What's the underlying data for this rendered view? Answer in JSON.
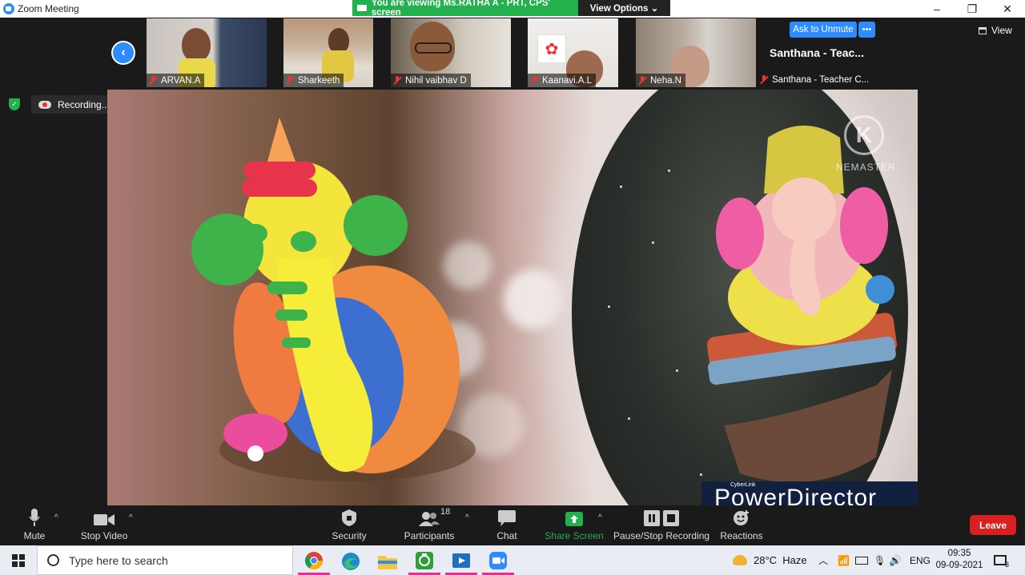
{
  "window": {
    "title": "Zoom Meeting",
    "minimize": "–",
    "maximize": "❐",
    "close": "✕"
  },
  "share_banner": {
    "viewing_text": "You are viewing Ms.RATHA A - PRT, CPS' screen",
    "view_options": "View Options ⌄"
  },
  "gallery": {
    "participants": [
      {
        "name": "ARVAN.A"
      },
      {
        "name": "Sharkeeth"
      },
      {
        "name": "Nihil vaibhav D"
      },
      {
        "name": "Kaanavi.A.L"
      },
      {
        "name": "Neha.N"
      }
    ],
    "host_tile": {
      "ask_unmute": "Ask to Unmute",
      "more": "•••",
      "display_name": "Santhana - Teac...",
      "label": "Santhana - Teacher C..."
    },
    "view_label": "View"
  },
  "recording": {
    "status": "Recording..."
  },
  "shared_content": {
    "watermark": "NEMASTER",
    "brand": "CyberLink",
    "product": "PowerDirector"
  },
  "toolbar": {
    "mute": "Mute",
    "stop_video": "Stop Video",
    "security": "Security",
    "participants": "Participants",
    "participant_count": "18",
    "chat": "Chat",
    "share_screen": "Share Screen",
    "pause_stop_recording": "Pause/Stop Recording",
    "reactions": "Reactions",
    "leave": "Leave"
  },
  "taskbar": {
    "search_placeholder": "Type here to search",
    "weather_temp": "28°C",
    "weather_text": "Haze",
    "language": "ENG",
    "time": "09:35",
    "date": "09-09-2021",
    "notification_count": "3"
  },
  "colors": {
    "zoom_blue": "#2d8cff",
    "share_green": "#22b14c",
    "leave_red": "#d92020"
  }
}
